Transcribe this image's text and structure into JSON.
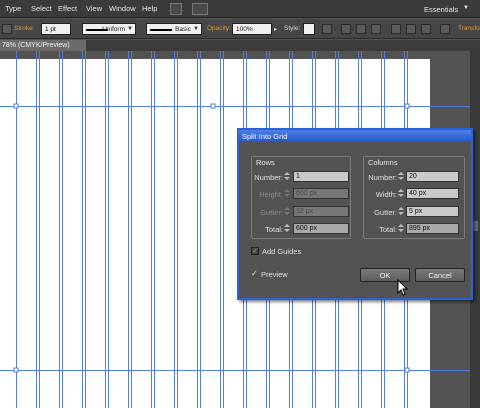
{
  "menubar": {
    "items": [
      "Type",
      "Select",
      "Effect",
      "View",
      "Window",
      "Help"
    ],
    "workspace": "Essentials"
  },
  "control_bar": {
    "stroke_label": "Stroke:",
    "stroke_weight": "1 pt",
    "profile": "Uniform",
    "brush": "Basic",
    "opacity_label": "Opacity:",
    "opacity_value": "100%",
    "style_label": "Style:",
    "transform_label": "Transfo"
  },
  "document_tab": {
    "label": "78% (CMYK/Preview)"
  },
  "dialog": {
    "title": "Split Into Grid",
    "rows": {
      "title": "Rows",
      "number_label": "Number:",
      "number_value": "1",
      "height_label": "Height:",
      "height_value": "600 px",
      "gutter_label": "Gutter:",
      "gutter_value": "12 px",
      "total_label": "Total:",
      "total_value": "600 px"
    },
    "columns": {
      "title": "Columns",
      "number_label": "Number:",
      "number_value": "20",
      "width_label": "Width:",
      "width_value": "40 px",
      "gutter_label": "Gutter:",
      "gutter_value": "5 px",
      "total_label": "Total:",
      "total_value": "895 px"
    },
    "add_guides_label": "Add Guides",
    "add_guides_checked": true,
    "preview_label": "Preview",
    "preview_checked": true,
    "ok_label": "OK",
    "cancel_label": "Cancel"
  },
  "colors": {
    "guide": "#4f7fe0",
    "dialog_border": "#2d62d6",
    "accent_orange": "#e39a32"
  }
}
